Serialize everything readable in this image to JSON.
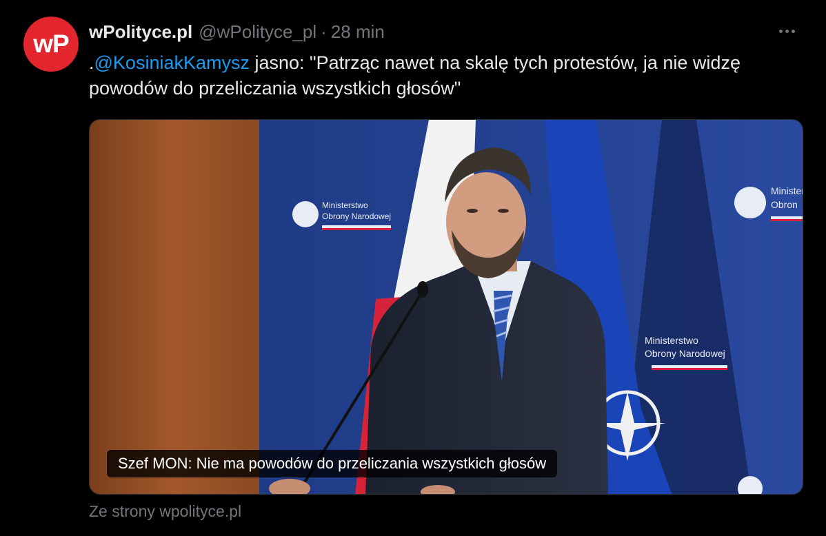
{
  "tweet": {
    "avatar_text": "wP",
    "display_name": "wPolityce.pl",
    "handle": "@wPolityce_pl",
    "separator": "·",
    "time": "28 min",
    "text_prefix": ".",
    "mention": "@KosiniakKamysz",
    "text_body": " jasno: \"Patrząc nawet na skalę tych protestów, ja nie widzę powodów do przeliczania wszystkich głosów\"",
    "more_icon": "more-horizontal-icon"
  },
  "card": {
    "caption": "Szef MON: Nie ma powodów do przeliczania wszystkich głosów",
    "source": "Ze strony wpolityce.pl",
    "backdrop_text_line1": "Ministerstwo",
    "backdrop_text_line2": "Obrony Narodowej",
    "backdrop_text_line1_cut": "Minister",
    "backdrop_text_line2_cut": "Obron"
  },
  "colors": {
    "background": "#000000",
    "text": "#e7e9ea",
    "muted": "#71767b",
    "link": "#1d9bf0",
    "avatar": "#e3262e"
  }
}
